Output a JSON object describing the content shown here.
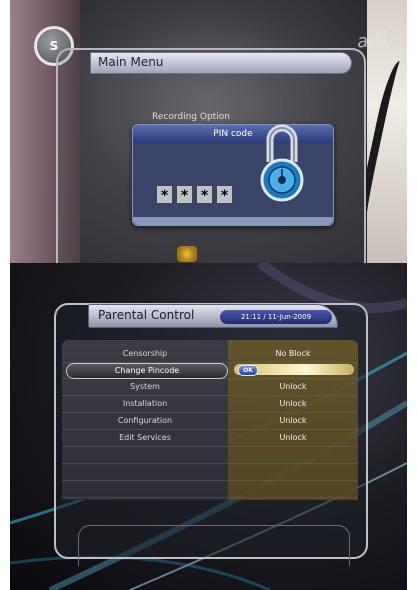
{
  "top_screen": {
    "main_menu_title": "Main Menu",
    "recording_option_label": "Recording Option",
    "pin_dialog": {
      "title": "PIN code",
      "digits": [
        "*",
        "*",
        "*",
        "*"
      ]
    },
    "watermark_text": "arti"
  },
  "parental_control": {
    "title": "Parental Control",
    "datetime": "21:11 / 11-Jun-2009",
    "rows": [
      {
        "label": "Censorship",
        "value": ""
      },
      {
        "label": "Change Pincode",
        "value": "OK"
      },
      {
        "label": "System",
        "value": "Unlock"
      },
      {
        "label": "Installation",
        "value": "Unlock"
      },
      {
        "label": "Configuration",
        "value": "Unlock"
      },
      {
        "label": "Edit Services",
        "value": "Unlock"
      }
    ],
    "censorship_value": "No Block"
  },
  "colors": {
    "title_bar": "#c8ccd8",
    "pin_header": "#3a4a90",
    "value_column": "#6b5a2a",
    "selected_highlight": "#f0e0a0"
  }
}
